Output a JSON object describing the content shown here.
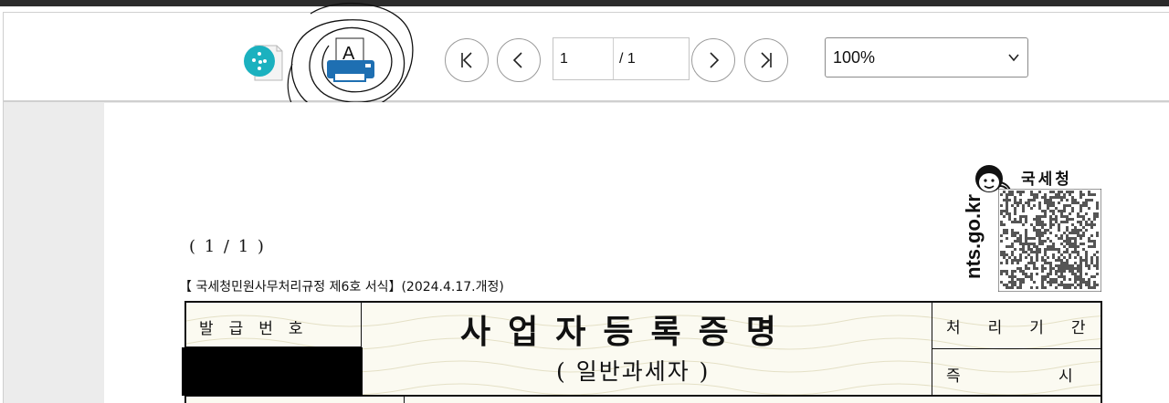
{
  "toolbar": {
    "save_doc_icon": "document-save-icon",
    "print_icon": "printer-icon",
    "print_tray_label": "A",
    "first_page_icon": "first-page-icon",
    "prev_page_icon": "previous-page-icon",
    "next_page_icon": "next-page-icon",
    "last_page_icon": "last-page-icon",
    "page_current": "1",
    "page_total": "/ 1",
    "zoom_value": "100%",
    "zoom_icon": "chevron-down-icon",
    "accent_color": "#1bb1bf",
    "printer_color": "#1e6fb2"
  },
  "document": {
    "page_indicator": "(   1 / 1   )",
    "form_reference": "【 국세청민원사무처리규정 제6호 서식】(2024.4.17.개정)",
    "agency_name": "국세청",
    "agency_url": "nts.go.kr",
    "agency_logo_icon": "nts-mascot-icon",
    "qr_icon": "qr-code-icon",
    "table": {
      "issue_number_label": "발급번호",
      "title": "사업자등록증명",
      "subtitle": "( 일반과세자 )",
      "processing_period_label": "처리기간",
      "processing_period_value_a": "즉",
      "processing_period_value_b": "시"
    }
  }
}
